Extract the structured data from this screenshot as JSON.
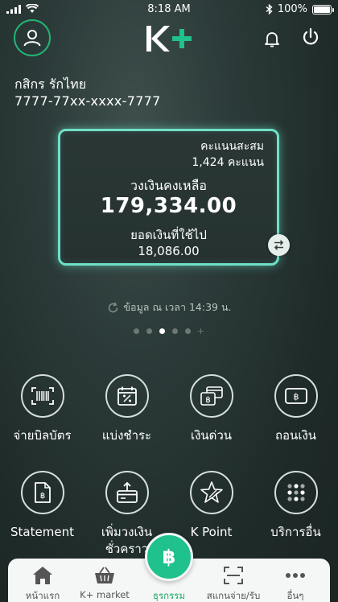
{
  "status_bar": {
    "time": "8:18 AM",
    "battery": "100%"
  },
  "header": {
    "logo_text": "K+"
  },
  "user": {
    "name": "กสิกร รักไทย",
    "account_number": "7777-77xx-xxxx-7777"
  },
  "card": {
    "points_label": "คะแนนสะสม",
    "points_value": "1,424  คะแนน",
    "credit_label": "วงเงินคงเหลือ",
    "credit_value": "179,334.00",
    "used_label": "ยอดเงินที่ใช้ไป",
    "used_value": "18,086.00"
  },
  "updated_text": "ข้อมูล ณ เวลา 14:39 น.",
  "pagination": {
    "total_dots": 5,
    "active_index": 2
  },
  "menu": [
    {
      "label": "จ่ายบิลบัตร",
      "icon": "barcode-icon"
    },
    {
      "label": "แบ่งชำระ",
      "icon": "installment-calendar-icon"
    },
    {
      "label": "เงินด่วน",
      "icon": "cash-card-icon"
    },
    {
      "label": "ถอนเงิน",
      "icon": "withdraw-icon"
    },
    {
      "label": "Statement",
      "icon": "statement-icon"
    },
    {
      "label": "เพิ่มวงเงิน\nชั่วคราว",
      "icon": "increase-limit-icon"
    },
    {
      "label": "K Point",
      "icon": "star-icon"
    },
    {
      "label": "บริการอื่น",
      "icon": "more-services-icon"
    }
  ],
  "bottom_nav": [
    {
      "label": "หน้าแรก",
      "icon": "home-icon"
    },
    {
      "label": "K+ market",
      "icon": "basket-icon"
    },
    {
      "label": "ธุรกรรม",
      "icon": "baht-icon"
    },
    {
      "label": "สแกนจ่าย/รับ",
      "icon": "scan-icon"
    },
    {
      "label": "อื่นๆ",
      "icon": "more-icon"
    }
  ],
  "colors": {
    "accent": "#1fc18c",
    "card_border": "#6ee0c8",
    "avatar_ring": "#21b573"
  }
}
